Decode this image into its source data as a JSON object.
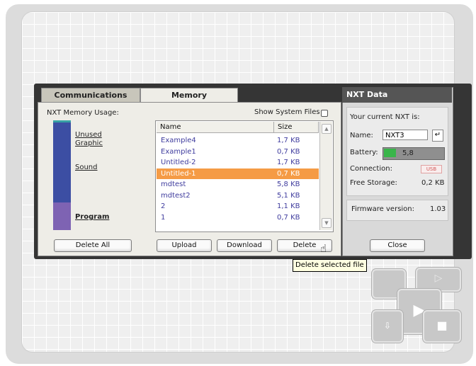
{
  "tabs": {
    "communications": "Communications",
    "memory": "Memory"
  },
  "memory": {
    "usage_label": "NXT Memory Usage:",
    "legend": {
      "unused": "Unused",
      "graphic": "Graphic",
      "sound": "Sound",
      "program": "Program"
    },
    "show_system_files_label": "Show System Files",
    "show_system_files_checked": false,
    "delete_all_label": "Delete All"
  },
  "file_list": {
    "columns": {
      "name": "Name",
      "size": "Size"
    },
    "rows": [
      {
        "name": "Example4",
        "size": "1,7 KB"
      },
      {
        "name": "Example1",
        "size": "0,7 KB"
      },
      {
        "name": "Untitled-2",
        "size": "1,7 KB"
      },
      {
        "name": "Untitled-1",
        "size": "0,7 KB",
        "selected": true
      },
      {
        "name": "mdtest",
        "size": "5,8 KB"
      },
      {
        "name": "mdtest2",
        "size": "5,1 KB"
      },
      {
        "name": "2",
        "size": "1,1 KB"
      },
      {
        "name": "1",
        "size": "0,7 KB"
      }
    ],
    "buttons": {
      "upload": "Upload",
      "download": "Download",
      "delete": "Delete"
    }
  },
  "tooltip": "Delete selected file",
  "nxt_data": {
    "title": "NXT Data",
    "current_label": "Your current NXT is:",
    "name_label": "Name:",
    "name_value": "NXT3",
    "battery_label": "Battery:",
    "battery_value": "5,8",
    "connection_label": "Connection:",
    "connection_value": "USB",
    "free_storage_label": "Free Storage:",
    "free_storage_value": "0,2 KB",
    "firmware_label": "Firmware version:",
    "firmware_value": "1.03",
    "close_label": "Close"
  },
  "colors": {
    "selected_row": "#f59b45",
    "file_text": "#3f3c9e",
    "memory_bar": "#3c4ea3",
    "program_bar": "#7e63b3",
    "battery_fill": "#39b54a"
  }
}
